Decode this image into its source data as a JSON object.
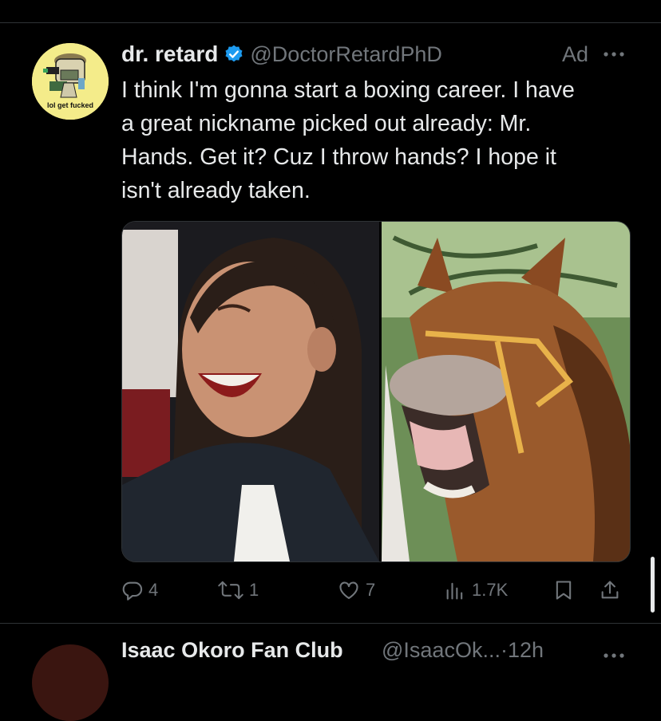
{
  "tweet": {
    "avatar_text": "lol get fucked",
    "display_name": "dr. retard",
    "handle": "@DoctorRetardPhD",
    "ad_label": "Ad",
    "text": "I think I'm gonna start a boxing career. I have\na great nickname picked out already: Mr.\nHands. Get it? Cuz I throw hands? I hope it\nisn't already taken.",
    "media": {
      "left_image": "photo-laughing-woman",
      "right_image": "photo-laughing-horse"
    },
    "actions": {
      "replies": "4",
      "reposts": "1",
      "likes": "7",
      "views": "1.7K"
    },
    "colors": {
      "background": "#000000",
      "text": "#e7e9ea",
      "secondary": "#71767b",
      "verified": "#1d9bf0",
      "divider": "#2f3336"
    }
  },
  "next_tweet": {
    "display_name": "Isaac Okoro Fan Club",
    "handle": "@IsaacOk...·12h"
  }
}
